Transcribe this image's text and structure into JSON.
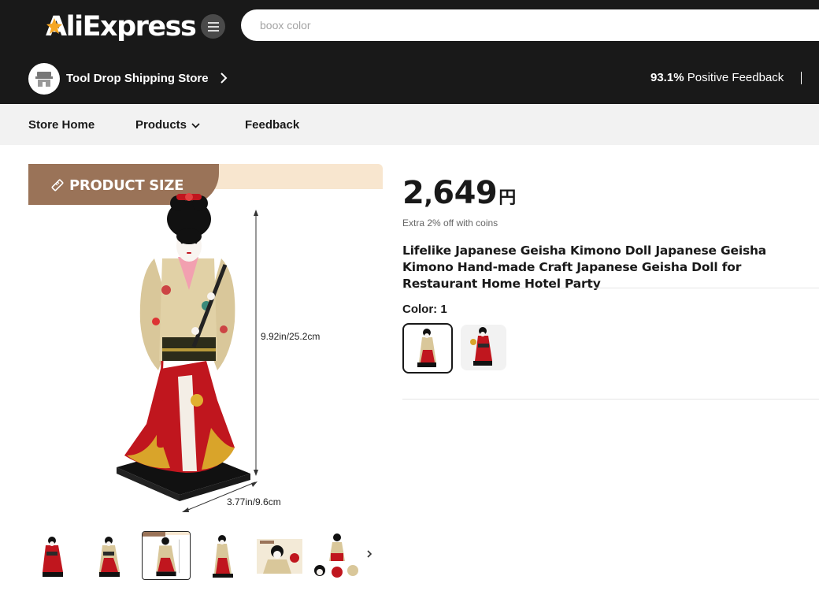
{
  "header": {
    "logo_text": "AliExpress",
    "search_placeholder": "boox color"
  },
  "store": {
    "name": "Tool Drop Shipping Store",
    "feedback_percent": "93.1%",
    "feedback_label": "Positive Feedback"
  },
  "nav": {
    "items": [
      {
        "label": "Store Home"
      },
      {
        "label": "Products"
      },
      {
        "label": "Feedback"
      }
    ]
  },
  "gallery": {
    "banner_label": "PRODUCT SIZE",
    "height_dim": "9.92in/25.2cm",
    "width_dim": "3.77in/9.6cm",
    "active_thumb_index": 2,
    "thumb_count": 6
  },
  "product": {
    "price_main": "2",
    "price_comma": ",",
    "price_rest": "649",
    "currency": "円",
    "coins_note": "Extra 2% off with coins",
    "title": "Lifelike Japanese Geisha Kimono Doll Japanese Geisha Kimono Hand-made Craft Japanese Geisha Doll for Restaurant Home Hotel Party",
    "color_label": "Color: 1",
    "selected_color_index": 0
  },
  "colors": {
    "brand_dark": "#191919",
    "banner_brown": "#9a7358",
    "banner_cream": "#f8e6cf",
    "kimono_red": "#c0161e",
    "kimono_gold": "#d9c79a"
  }
}
